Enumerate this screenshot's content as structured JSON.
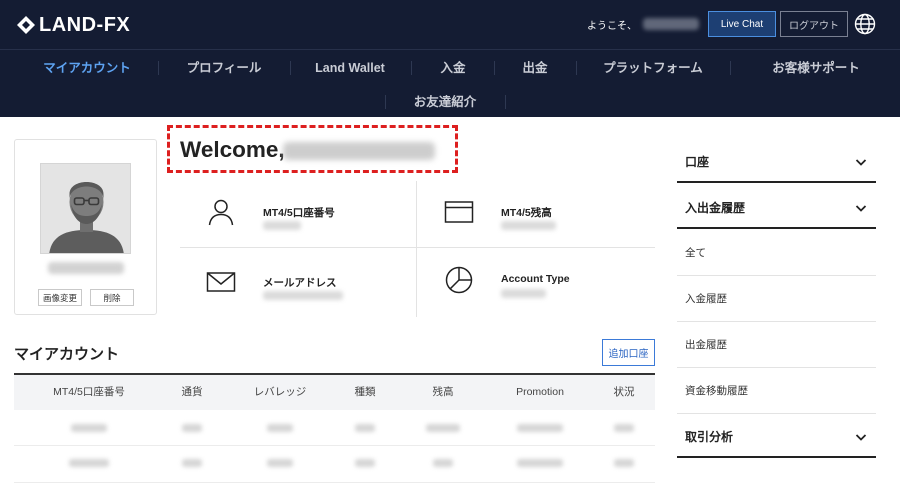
{
  "header": {
    "logo_text": "LAND-FX",
    "welcome_prefix": "ようこそ、",
    "live_chat": "Live Chat",
    "logout": "ログアウト",
    "globe_icon": "globe-icon"
  },
  "nav": {
    "items": [
      {
        "label": "マイアカウント",
        "active": true
      },
      {
        "label": "プロフィール"
      },
      {
        "label": "Land Wallet"
      },
      {
        "label": "入金"
      },
      {
        "label": "出金"
      },
      {
        "label": "プラットフォーム"
      },
      {
        "label": "お客様サポート"
      }
    ],
    "row2": {
      "label": "お友達紹介"
    },
    "active_color": "#5ea3f2"
  },
  "profile": {
    "change_image": "画像変更",
    "delete": "削除"
  },
  "welcome": {
    "title": "Welcome,"
  },
  "info": {
    "account_number": {
      "label": "MT4/5口座番号",
      "icon": "user-icon"
    },
    "balance": {
      "label": "MT4/5残高",
      "icon": "card-icon"
    },
    "email": {
      "label": "メールアドレス",
      "icon": "mail-icon"
    },
    "account_type": {
      "label": "Account Type",
      "icon": "pie-chart-icon"
    }
  },
  "accounts": {
    "title": "マイアカウント",
    "add_button": "追加口座",
    "columns": [
      "MT4/5口座番号",
      "通貨",
      "レバレッジ",
      "種類",
      "残高",
      "Promotion",
      "状況"
    ]
  },
  "sidebar": {
    "sections": [
      {
        "label": "口座",
        "icon": "chevron-down-icon"
      },
      {
        "label": "入出金履歴",
        "icon": "chevron-down-icon"
      }
    ],
    "items": [
      "全て",
      "入金履歴",
      "出金履歴",
      "資金移動履歴"
    ],
    "footer_section": {
      "label": "取引分析",
      "icon": "chevron-down-icon"
    }
  },
  "colors": {
    "header_bg": "#141c33",
    "accent_blue": "#3b7ad8",
    "highlight_red": "#dd1f1f"
  }
}
